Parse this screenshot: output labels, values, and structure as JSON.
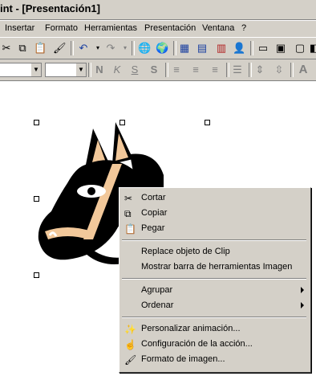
{
  "window": {
    "title": "int - [Presentación1]"
  },
  "menu": {
    "items": [
      "Insertar",
      "Formato",
      "Herramientas",
      "Presentación",
      "Ventana",
      "?"
    ]
  },
  "toolbar2": {
    "bold": "N",
    "italic": "K",
    "underline": "S",
    "shadow": "S"
  },
  "context_menu": {
    "cut": "Cortar",
    "copy": "Copiar",
    "paste": "Pegar",
    "replace_clip": "Replace objeto de Clip",
    "show_image_toolbar": "Mostrar barra de herramientas Imagen",
    "group": "Agrupar",
    "order": "Ordenar",
    "custom_animation": "Personalizar animación...",
    "action_settings": "Configuración de la acción...",
    "format_image": "Formato de imagen..."
  }
}
